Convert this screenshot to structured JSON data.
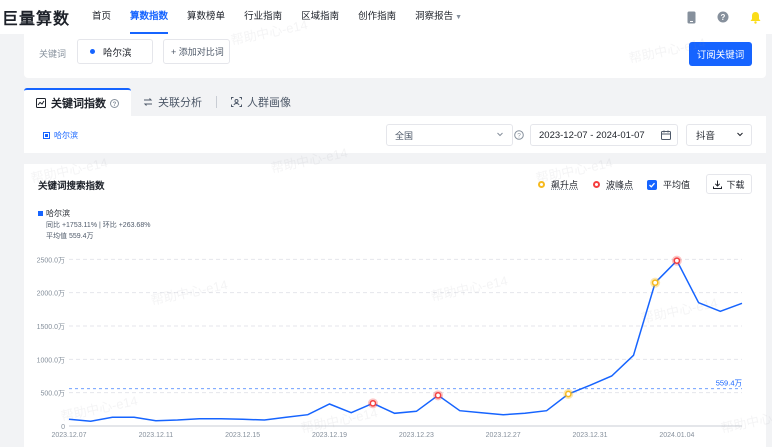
{
  "brand": {
    "logo": "巨量算数"
  },
  "nav": {
    "items": [
      "首页",
      "算数指数",
      "算数榜单",
      "行业指南",
      "区域指南",
      "创作指南",
      "洞察报告"
    ],
    "active_index": 1
  },
  "keyword_bar": {
    "label": "关键词",
    "keyword": "哈尔滨",
    "add_compare": "+ 添加对比词",
    "subscribe": "订阅关键词"
  },
  "tabs": [
    {
      "label": "关键词指数",
      "icon": "analytics-icon"
    },
    {
      "label": "关联分析",
      "icon": "link-icon"
    },
    {
      "label": "人群画像",
      "icon": "user-group-icon"
    }
  ],
  "filters": {
    "keyword_legend": "哈尔滨",
    "region": "全国",
    "date_range": "2023-12-07 - 2024-01-07",
    "platform": "抖音"
  },
  "chart_card": {
    "title": "关键词搜索指数",
    "legend_surge": "飙升点",
    "legend_peak": "波峰点",
    "legend_avg": "平均值",
    "download": "下载",
    "series_name": "哈尔滨",
    "yoy": "同比 +1753.11%",
    "mom": "环比 +263.68%",
    "avg_text": "平均值 559.4万",
    "avg_label": "559.4万"
  },
  "watermark_text": "帮助中心-e14",
  "colors": {
    "accent": "#1664ff",
    "surge": "#f7ba1e",
    "peak": "#f53f3f",
    "grid": "#e5e6eb"
  },
  "chart_data": {
    "type": "line",
    "x": [
      "2023.12.07",
      "2023.12.08",
      "2023.12.09",
      "2023.12.10",
      "2023.12.11",
      "2023.12.12",
      "2023.12.13",
      "2023.12.14",
      "2023.12.15",
      "2023.12.16",
      "2023.12.17",
      "2023.12.18",
      "2023.12.19",
      "2023.12.20",
      "2023.12.21",
      "2023.12.22",
      "2023.12.23",
      "2023.12.24",
      "2023.12.25",
      "2023.12.26",
      "2023.12.27",
      "2023.12.28",
      "2023.12.29",
      "2023.12.30",
      "2023.12.31",
      "2024.01.01",
      "2024.01.02",
      "2024.01.03",
      "2024.01.04",
      "2024.01.05",
      "2024.01.06",
      "2024.01.07"
    ],
    "xticks": [
      "2023.12.07",
      "2023.12.11",
      "2023.12.15",
      "2023.12.19",
      "2023.12.23",
      "2023.12.27",
      "2023.12.31",
      "2024.01.04"
    ],
    "yticks": [
      "0",
      "500.0万",
      "1000.0万",
      "1500.0万",
      "2000.0万",
      "2500.0万"
    ],
    "series": [
      {
        "name": "哈尔滨",
        "values": [
          100,
          70,
          130,
          130,
          80,
          90,
          110,
          110,
          100,
          90,
          130,
          170,
          330,
          200,
          340,
          190,
          220,
          460,
          230,
          200,
          170,
          190,
          230,
          480,
          610,
          750,
          1060,
          2150,
          2480,
          1850,
          1720,
          1840
        ]
      }
    ],
    "surge_points": [
      23,
      27
    ],
    "peak_points": [
      14,
      17,
      28
    ],
    "average": 559.4,
    "ylim": [
      0,
      2700
    ],
    "unit": "万",
    "grid": true
  }
}
